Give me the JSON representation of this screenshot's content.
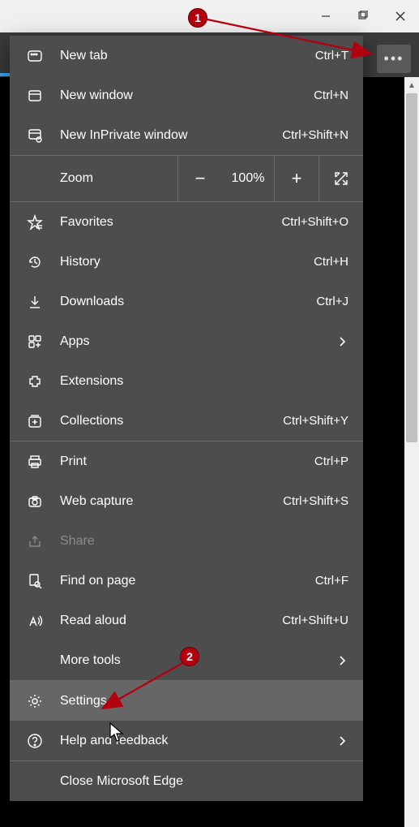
{
  "titlebar": {
    "minimize": "minimize",
    "maximize": "maximize",
    "close": "close"
  },
  "more_button": "...",
  "zoom": {
    "label": "Zoom",
    "value": "100%",
    "minus": "−",
    "plus": "+"
  },
  "menu": {
    "new_tab": {
      "label": "New tab",
      "shortcut": "Ctrl+T"
    },
    "new_window": {
      "label": "New window",
      "shortcut": "Ctrl+N"
    },
    "new_inprivate": {
      "label": "New InPrivate window",
      "shortcut": "Ctrl+Shift+N"
    },
    "favorites": {
      "label": "Favorites",
      "shortcut": "Ctrl+Shift+O"
    },
    "history": {
      "label": "History",
      "shortcut": "Ctrl+H"
    },
    "downloads": {
      "label": "Downloads",
      "shortcut": "Ctrl+J"
    },
    "apps": {
      "label": "Apps"
    },
    "extensions": {
      "label": "Extensions"
    },
    "collections": {
      "label": "Collections",
      "shortcut": "Ctrl+Shift+Y"
    },
    "print": {
      "label": "Print",
      "shortcut": "Ctrl+P"
    },
    "web_capture": {
      "label": "Web capture",
      "shortcut": "Ctrl+Shift+S"
    },
    "share": {
      "label": "Share"
    },
    "find": {
      "label": "Find on page",
      "shortcut": "Ctrl+F"
    },
    "read_aloud": {
      "label": "Read aloud",
      "shortcut": "Ctrl+Shift+U"
    },
    "more_tools": {
      "label": "More tools"
    },
    "settings": {
      "label": "Settings"
    },
    "help": {
      "label": "Help and feedback"
    },
    "close_edge": {
      "label": "Close Microsoft Edge"
    }
  },
  "annotations": {
    "b1": "1",
    "b2": "2"
  }
}
